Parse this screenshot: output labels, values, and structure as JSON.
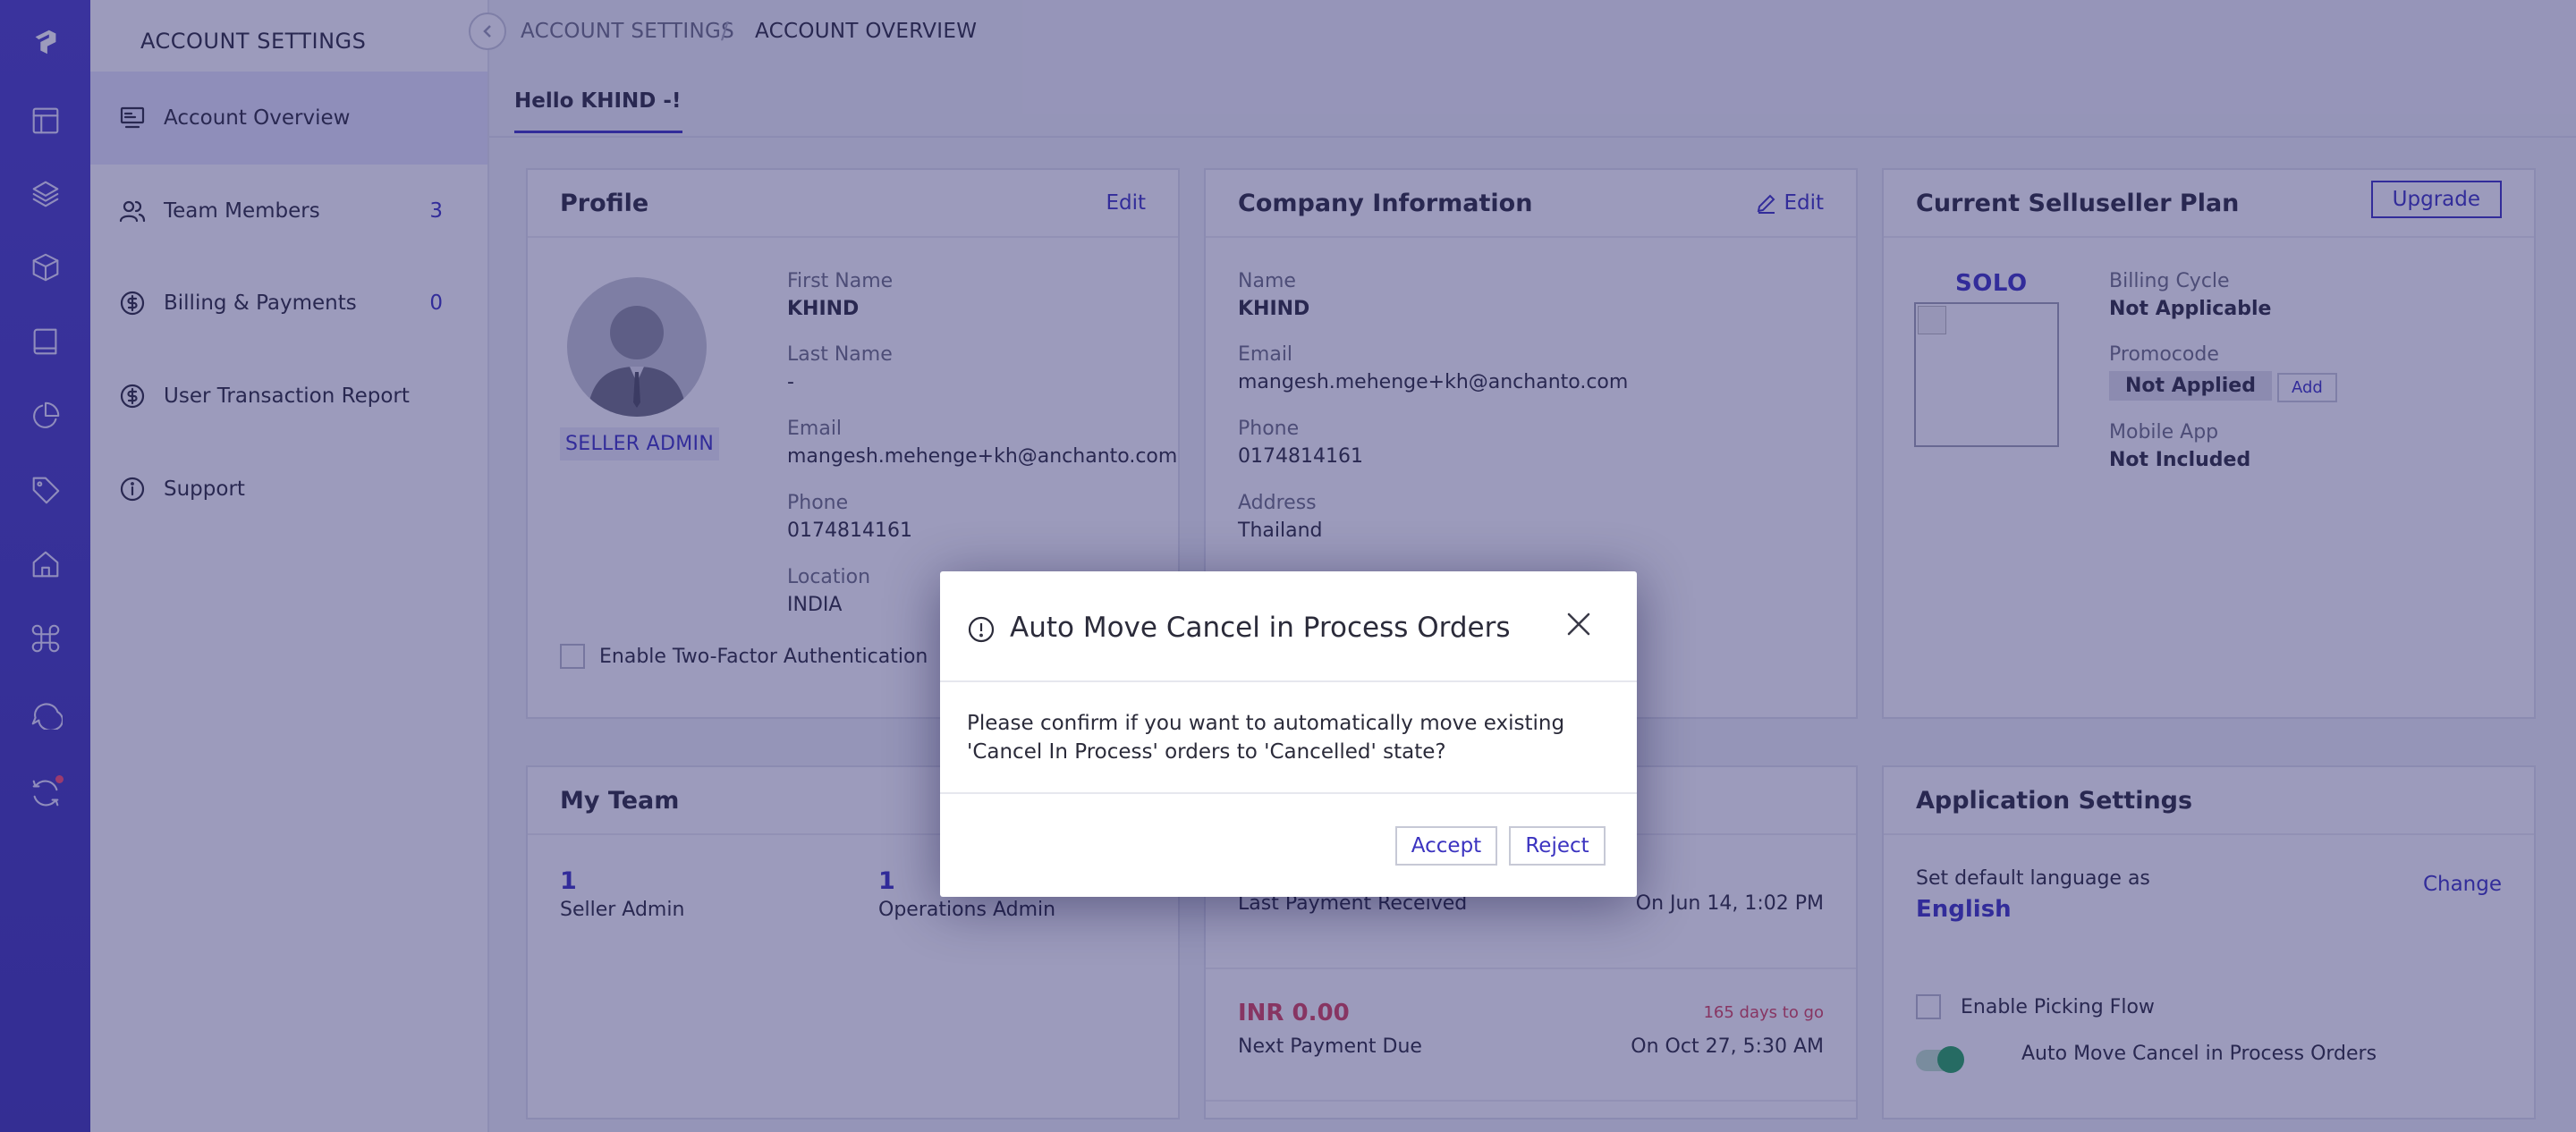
{
  "rail": {
    "icons": [
      "logo-icon",
      "layout-icon",
      "layers-icon",
      "box-icon",
      "book-icon",
      "pie-chart-icon",
      "tag-icon",
      "home-icon",
      "command-icon",
      "chat-icon",
      "sync-icon"
    ]
  },
  "sidebar": {
    "title": "ACCOUNT SETTINGS",
    "items": [
      {
        "label": "Account Overview",
        "count": "",
        "icon": "monitor-icon"
      },
      {
        "label": "Team Members",
        "count": "3",
        "icon": "users-icon"
      },
      {
        "label": "Billing & Payments",
        "count": "0",
        "icon": "dollar-icon"
      },
      {
        "label": "User Transaction Report",
        "count": "",
        "icon": "dollar-icon"
      },
      {
        "label": "Support",
        "count": "",
        "icon": "info-icon"
      }
    ]
  },
  "breadcrumb": {
    "first": "ACCOUNT SETTINGS",
    "separator": "/",
    "second": "ACCOUNT OVERVIEW"
  },
  "tab": {
    "label": "Hello KHIND -!"
  },
  "profile": {
    "title": "Profile",
    "edit": "Edit",
    "role": "SELLER ADMIN",
    "first_name_label": "First Name",
    "first_name": "KHIND",
    "last_name_label": "Last Name",
    "last_name": "-",
    "email_label": "Email",
    "email": "mangesh.mehenge+kh@anchanto.com",
    "phone_label": "Phone",
    "phone": "0174814161",
    "location_label": "Location",
    "location": "INDIA",
    "two_factor_label": "Enable Two-Factor Authentication"
  },
  "company": {
    "title": "Company Information",
    "edit": "Edit",
    "name_label": "Name",
    "name": "KHIND",
    "email_label": "Email",
    "email": "mangesh.mehenge+kh@anchanto.com",
    "phone_label": "Phone",
    "phone": "0174814161",
    "address_label": "Address",
    "address": "Thailand"
  },
  "plan": {
    "title": "Current Selluseller Plan",
    "upgrade": "Upgrade",
    "name": "SOLO",
    "billing_label": "Billing Cycle",
    "billing": "Not Applicable",
    "promo_label": "Promocode",
    "promo": "Not Applied",
    "promo_add": "Add",
    "mobile_label": "Mobile App",
    "mobile": "Not Included"
  },
  "team": {
    "title": "My Team",
    "seller_admin_count": "1",
    "seller_admin_label": "Seller Admin",
    "ops_admin_count": "1",
    "ops_admin_label": "Operations Admin"
  },
  "payments": {
    "last_label": "Last Payment Received",
    "last_date": "On Jun 14, 1:02 PM",
    "next_amount": "INR 0.00",
    "days_to_go": "165 days to go",
    "next_label": "Next Payment Due",
    "next_date": "On Oct 27, 5:30 AM"
  },
  "app_settings": {
    "title": "Application Settings",
    "language_label": "Set default language as",
    "language": "English",
    "change": "Change",
    "picking_label": "Enable Picking Flow",
    "auto_move_label": "Auto Move Cancel in Process Orders"
  },
  "modal": {
    "title": "Auto Move Cancel in Process Orders",
    "body": "Please confirm if you want to automatically move existing 'Cancel In Process' orders to 'Cancelled' state?",
    "accept": "Accept",
    "reject": "Reject"
  },
  "colors": {
    "accent": "#3b33c0",
    "rail": "#4a3fc6",
    "due": "#d9435a",
    "toggle_on": "#26a65b"
  }
}
